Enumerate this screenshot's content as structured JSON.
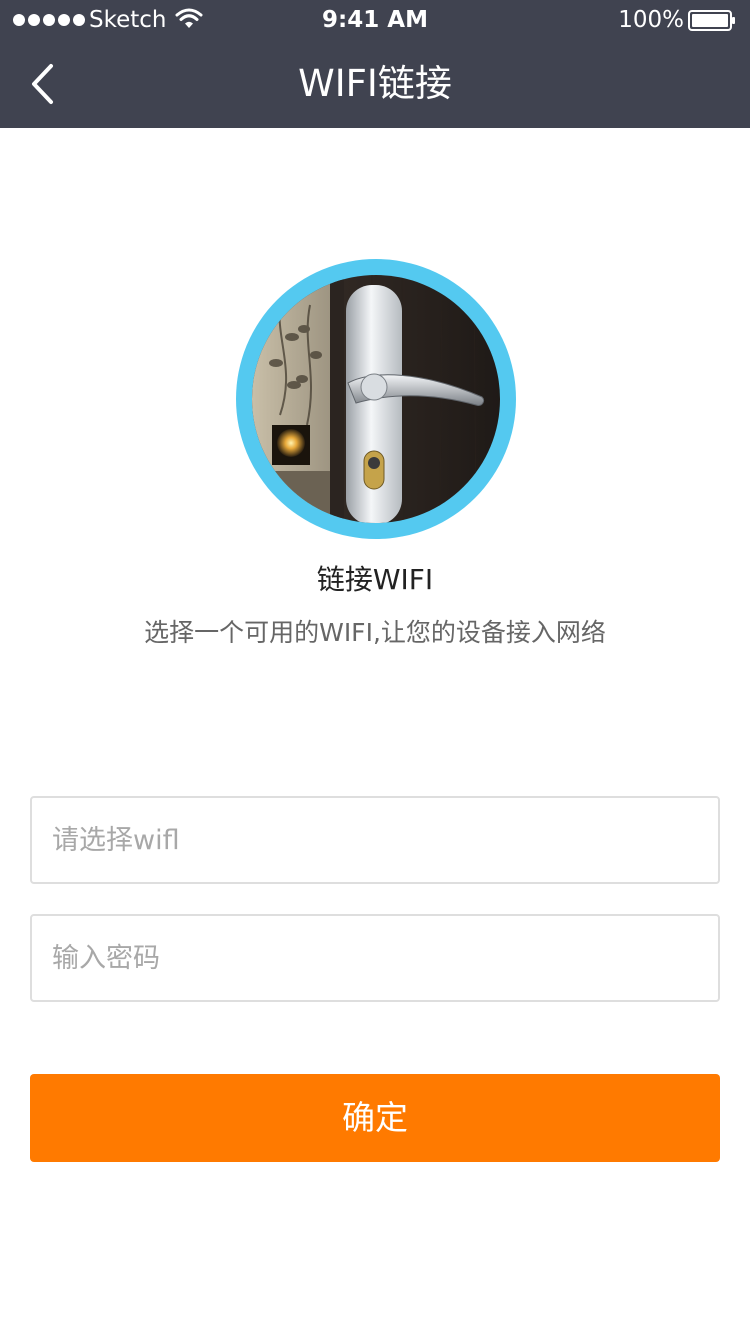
{
  "status_bar": {
    "carrier": "Sketch",
    "time": "9:41 AM",
    "battery": "100%"
  },
  "nav": {
    "title": "WIFI链接",
    "back_icon": "chevron-left-icon"
  },
  "hero": {
    "image": "door-lock-handle-photo"
  },
  "content": {
    "heading": "链接WIFI",
    "description": "选择一个可用的WIFI,让您的设备接入网络"
  },
  "form": {
    "wifi_placeholder": "请选择wifl",
    "password_placeholder": "输入密码",
    "confirm_label": "确定"
  },
  "colors": {
    "nav_bg": "#404350",
    "accent_orange": "#ff7a00",
    "ring_blue": "#54c9f0"
  }
}
